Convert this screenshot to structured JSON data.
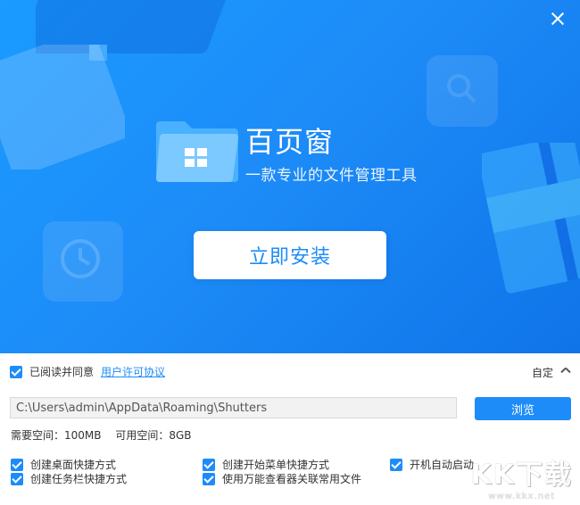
{
  "hero": {
    "app_name": "百页窗",
    "slogan": "一款专业的文件管理工具",
    "install_label": "立即安装",
    "bg_color": "#1d8cf8"
  },
  "license": {
    "checked": true,
    "agree_text": "已阅读并同意",
    "link_text": "用户许可协议"
  },
  "custom": {
    "label": "自定"
  },
  "install_path": {
    "value": "C:\\Users\\admin\\AppData\\Roaming\\Shutters",
    "browse_label": "浏览"
  },
  "space": {
    "required": "需要空间：100MB",
    "available": "可用空间：8GB"
  },
  "options": [
    {
      "label": "创建桌面快捷方式",
      "checked": true
    },
    {
      "label": "创建开始菜单快捷方式",
      "checked": true
    },
    {
      "label": "开机自动启动",
      "checked": true
    },
    {
      "label": "创建任务栏快捷方式",
      "checked": true
    },
    {
      "label": "使用万能查看器关联常用文件",
      "checked": true
    }
  ],
  "watermark": {
    "logo": "KK下载",
    "url": "www.kkx.net"
  },
  "icons": [
    "close-icon",
    "folder-app-icon",
    "search-icon",
    "clock-icon",
    "chevron-up-icon",
    "checkbox-icon"
  ]
}
